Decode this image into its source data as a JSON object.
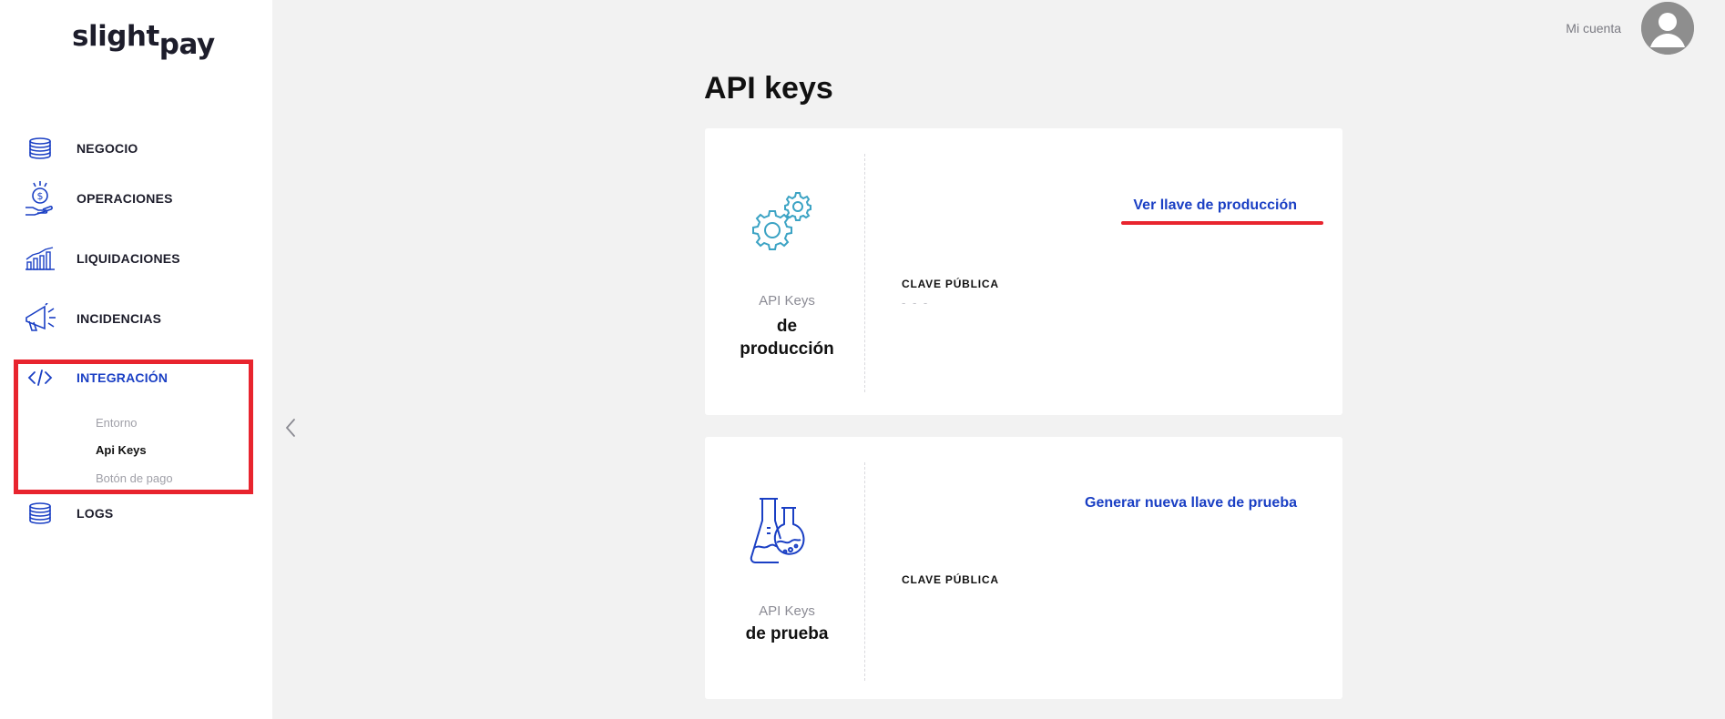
{
  "brand": {
    "logo_main": "slight",
    "logo_sub": "pay"
  },
  "header": {
    "account_label": "Mi cuenta"
  },
  "sidebar": {
    "items": [
      {
        "label": "NEGOCIO",
        "icon": "coins-stack-icon"
      },
      {
        "label": "OPERACIONES",
        "icon": "hand-dollar-icon"
      },
      {
        "label": "LIQUIDACIONES",
        "icon": "bar-chart-icon"
      },
      {
        "label": "INCIDENCIAS",
        "icon": "megaphone-icon"
      },
      {
        "label": "INTEGRACIÓN",
        "icon": "code-icon",
        "active": true
      },
      {
        "label": "LOGS",
        "icon": "coins-stack-icon"
      }
    ],
    "subitems": [
      {
        "label": "Entorno"
      },
      {
        "label": "Api Keys",
        "current": true
      },
      {
        "label": "Botón de pago"
      }
    ]
  },
  "main": {
    "title": "API keys",
    "production": {
      "caption": "API Keys",
      "strong_line1": "de",
      "strong_line2": "producción",
      "link": "Ver llave de producción",
      "field_label": "CLAVE PÚBLICA",
      "field_value": "- - -"
    },
    "test": {
      "caption": "API Keys",
      "strong_line1": "de prueba",
      "link": "Generar nueva llave de prueba",
      "field_label": "CLAVE PÚBLICA"
    }
  },
  "colors": {
    "accent": "#1a3fc4",
    "highlight": "#e8242e",
    "gear": "#3ba3c4",
    "flask": "#1a3fc4",
    "background": "#f2f2f2"
  }
}
